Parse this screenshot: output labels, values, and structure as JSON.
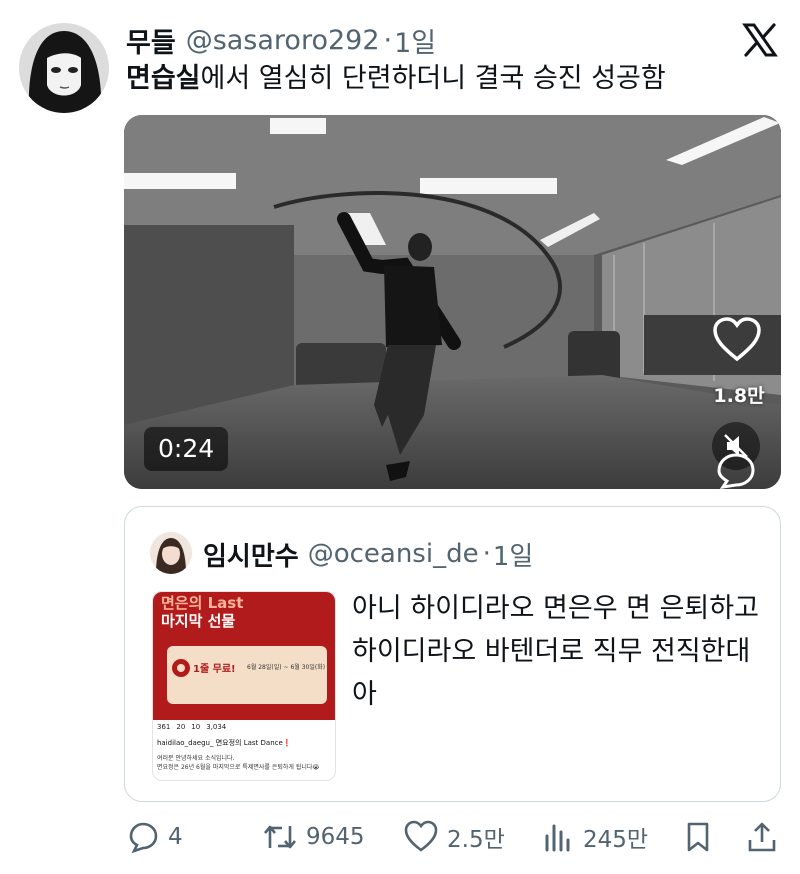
{
  "tweet": {
    "author_name": "무들",
    "author_handle": "@sasaroro292",
    "separator": "·",
    "time": "1일",
    "text_bold": "면습실",
    "text_rest": "에서 열심히 단련하더니 결국 승진 성공함"
  },
  "video": {
    "duration": "0:24",
    "like_count": "1.8만"
  },
  "quote": {
    "author_name": "임시만수",
    "author_handle": "@oceansi_de",
    "separator": "·",
    "time": "1일",
    "text": "아니 하이디라오 면은우 면 은퇴하고 하이디라오 바텐더로 직무 전직한대 아",
    "thumb": {
      "title_line1": "면은의 Last",
      "title_line2": "마지막 선물",
      "card_big": "1줄 무료!",
      "card_date": "6월 28일(일) ~ 6월 30일(화)",
      "stats": [
        "361",
        "20",
        "10",
        "3,034"
      ],
      "user": "haidilao_daegu_ 면요정의 Last Dance❗",
      "desc1": "여러분 안녕하세요 소식입니다.",
      "desc2": "면요정은 26년 6월을 마지막으로 특제면사를 은퇴하게 됩니다😭"
    }
  },
  "actions": {
    "replies": "4",
    "reposts": "9645",
    "likes": "2.5만",
    "views": "245만"
  },
  "icons": [
    "x-logo-icon",
    "heart-icon",
    "mute-icon",
    "comment-icon",
    "reply-icon",
    "repost-icon",
    "like-icon",
    "views-icon",
    "bookmark-icon",
    "share-icon"
  ],
  "colors": {
    "text": "#0f1419",
    "secondary": "#536471",
    "border": "#cfd9de"
  }
}
